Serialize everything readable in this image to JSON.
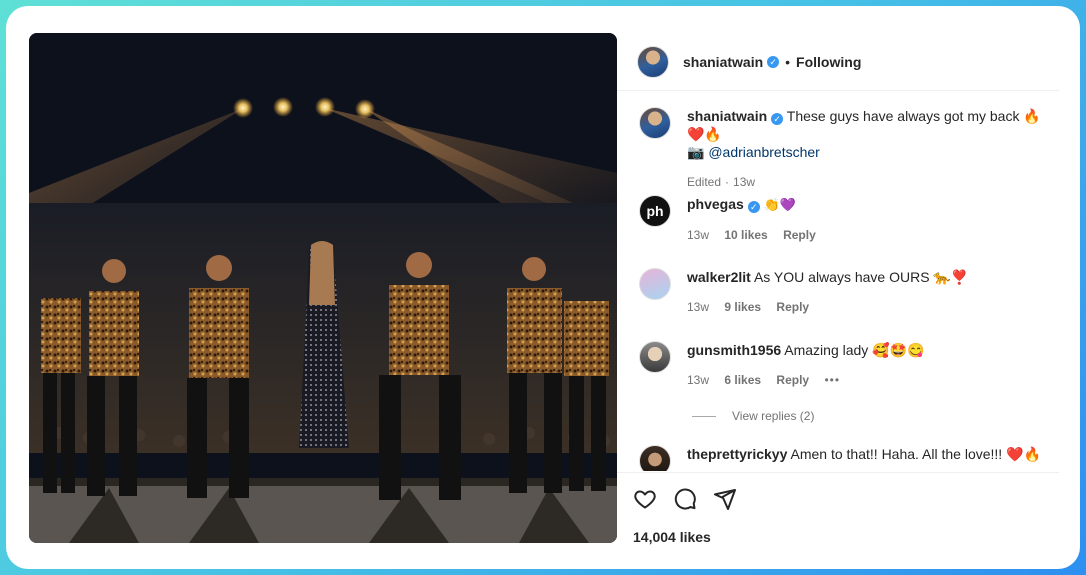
{
  "post": {
    "author": "shaniatwain",
    "follow_status": "Following",
    "separator": "•",
    "caption": "These guys have always got my back 🔥❤️🔥",
    "caption_credit_icon": "📷",
    "caption_credit": "@adrianbretscher",
    "edited_label": "Edited",
    "age": "13w",
    "likes": "14,004 likes"
  },
  "comments": [
    {
      "user": "phvegas",
      "avatar_text": "ph",
      "text": "👏💜",
      "age": "13w",
      "likes": "10 likes",
      "reply": "Reply"
    },
    {
      "user": "walker2lit",
      "text": "As YOU always have OURS 🐆❣️",
      "age": "13w",
      "likes": "9 likes",
      "reply": "Reply"
    },
    {
      "user": "gunsmith1956",
      "text": "Amazing lady 🥰🤩😋",
      "age": "13w",
      "likes": "6 likes",
      "reply": "Reply",
      "more": "•••",
      "view_replies": "View replies (2)"
    },
    {
      "user": "theprettyrickyy",
      "text": "Amen to that!! Haha. All the love!!! ❤️🔥"
    }
  ],
  "icons": {
    "verified": "verified-badge-icon",
    "like": "heart-icon",
    "comment": "comment-icon",
    "share": "paper-plane-icon"
  },
  "colors": {
    "accent": "#3897f0",
    "link": "#00376b",
    "muted": "#737373",
    "frame_gradient_start": "#5fe0d6",
    "frame_gradient_end": "#2d8ff0"
  }
}
